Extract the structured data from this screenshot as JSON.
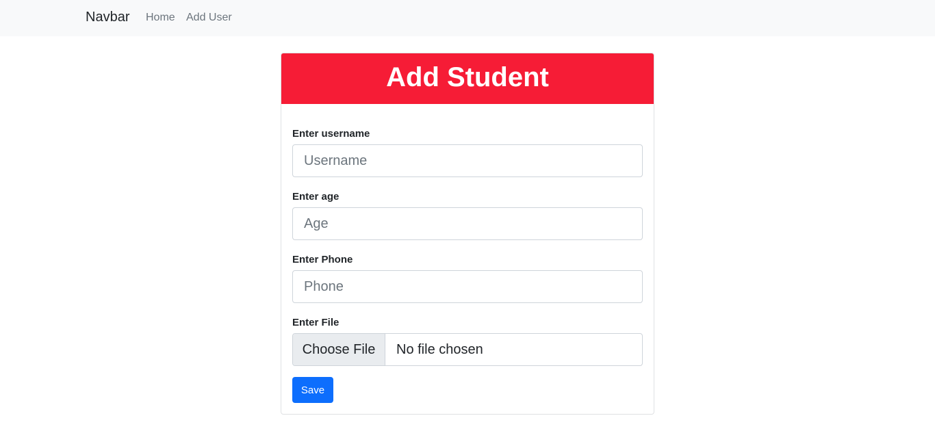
{
  "navbar": {
    "brand": "Navbar",
    "links": [
      "Home",
      "Add User"
    ]
  },
  "form": {
    "title": "Add Student",
    "fields": [
      {
        "label": "Enter username",
        "placeholder": "Username",
        "value": ""
      },
      {
        "label": "Enter age",
        "placeholder": "Age",
        "value": ""
      },
      {
        "label": "Enter Phone",
        "placeholder": "Phone",
        "value": ""
      }
    ],
    "file": {
      "label": "Enter File",
      "button_label": "Choose File",
      "status": "No file chosen"
    },
    "save_label": "Save"
  },
  "colors": {
    "header_bg": "#f61c36",
    "primary_button": "#0d6efd",
    "navbar_bg": "#f8f9fa"
  }
}
